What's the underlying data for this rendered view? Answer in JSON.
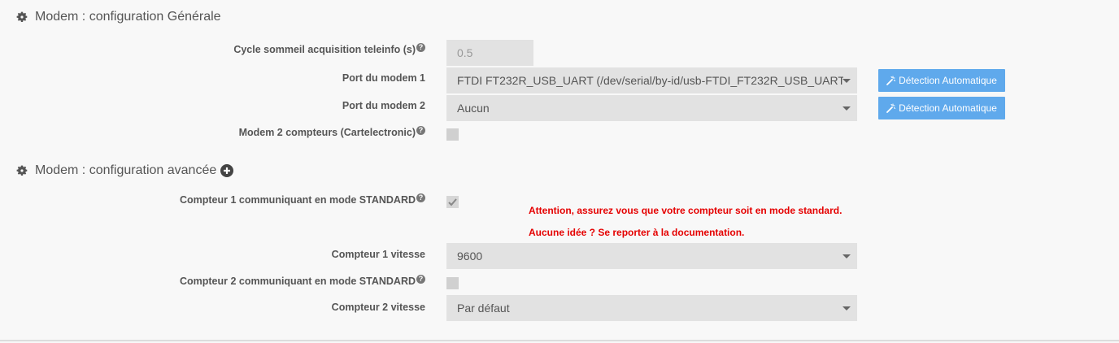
{
  "sections": {
    "general_title": "Modem : configuration Générale",
    "advanced_title": "Modem : configuration avancée"
  },
  "general": {
    "cycle_label": "Cycle sommeil acquisition teleinfo (s)",
    "cycle_value": "0.5",
    "port1_label": "Port du modem 1",
    "port1_value": "FTDI FT232R_USB_UART (/dev/serial/by-id/usb-FTDI_FT232R_USB_UART_",
    "port2_label": "Port du modem 2",
    "port2_value": "Aucun",
    "detect_label": "Détection Automatique",
    "modem2_label": "Modem 2 compteurs (Cartelectronic)"
  },
  "advanced": {
    "c1_standard_label": "Compteur 1 communiquant en mode STANDARD",
    "warning_line1": "Attention, assurez vous que votre compteur soit en mode standard.",
    "warning_line2": "Aucune idée ? Se reporter à la documentation.",
    "c1_speed_label": "Compteur 1 vitesse",
    "c1_speed_value": "9600",
    "c2_standard_label": "Compteur 2 communiquant en mode STANDARD",
    "c2_speed_label": "Compteur 2 vitesse",
    "c2_speed_value": "Par défaut"
  },
  "icons": {
    "help": "?",
    "section": "gear-icon",
    "expand": "plus-circle-icon",
    "detect": "magic-wand-icon"
  },
  "colors": {
    "accent": "#5fa9ec",
    "warning": "#e50000",
    "field_bg": "#e2e2e2"
  },
  "state": {
    "modem2_checked": false,
    "c1_standard_checked": true,
    "c2_standard_checked": false
  }
}
